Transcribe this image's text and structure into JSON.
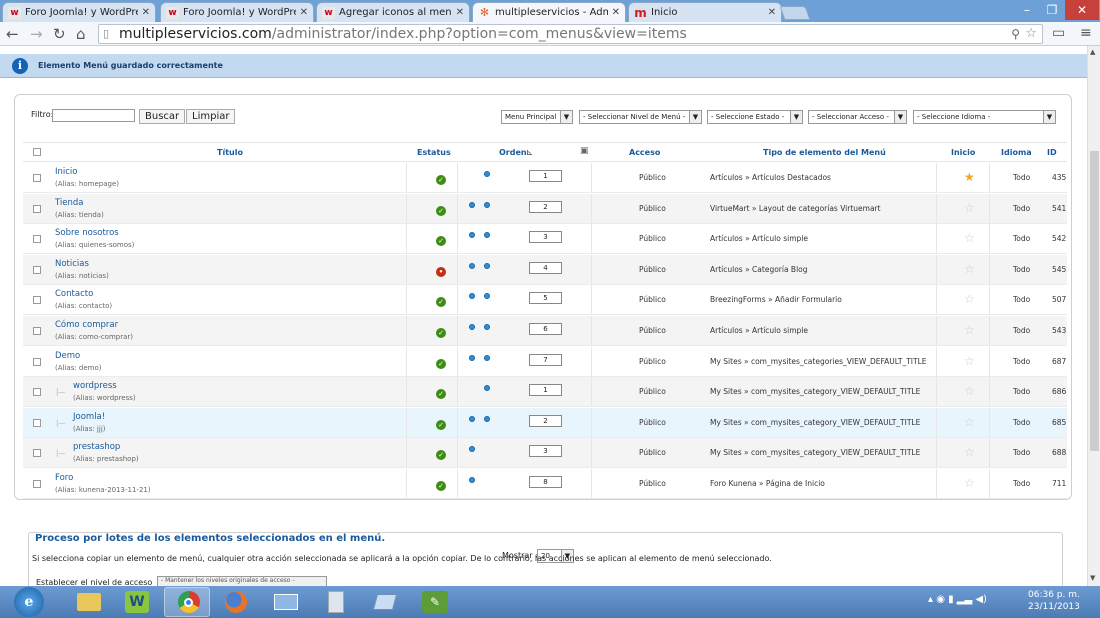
{
  "browser": {
    "tabs": [
      {
        "title": "Foro Joomla! y WordPress",
        "icon": "w",
        "active": false
      },
      {
        "title": "Foro Joomla! y WordPress",
        "icon": "w",
        "active": false
      },
      {
        "title": "Agregar iconos al menu d",
        "icon": "w",
        "active": false
      },
      {
        "title": "multipleservicios - Admin",
        "icon": "joomla",
        "active": true
      },
      {
        "title": "Inicio",
        "icon": "m",
        "active": false
      }
    ],
    "url_host": "multipleservicios.com",
    "url_path": "/administrator/index.php?option=com_menus&view=items"
  },
  "message": "Elemento Menú guardado correctamente",
  "filters": {
    "filtro_label": "Filtro:",
    "search_button": "Buscar",
    "clear_button": "Limpiar",
    "menu_select": "Menu Principal",
    "level_select": "- Seleccionar Nivel de Menú -",
    "state_select": "- Seleccione Estado -",
    "access_select": "- Seleccionar Acceso -",
    "language_select": "- Seleccione Idioma -"
  },
  "table": {
    "headers": {
      "title": "Título",
      "status": "Estatus",
      "order": "Orden",
      "access": "Acceso",
      "type": "Tipo de elemento del Menú",
      "home": "Inicio",
      "language": "Idioma",
      "id": "ID"
    },
    "rows": [
      {
        "title": "Inicio",
        "alias": "(Alias: homepage)",
        "status": "ok",
        "order": "1",
        "access": "Público",
        "type": "Artículos » Artículos Destacados",
        "home": true,
        "lang": "Todo",
        "id": "435",
        "level": 0,
        "up": false,
        "down": true
      },
      {
        "title": "Tienda",
        "alias": "(Alias: tienda)",
        "status": "ok",
        "order": "2",
        "access": "Público",
        "type": "VirtueMart » Layout de categorías Virtuemart",
        "home": false,
        "lang": "Todo",
        "id": "541",
        "level": 0,
        "up": true,
        "down": true
      },
      {
        "title": "Sobre nosotros",
        "alias": "(Alias: quienes-somos)",
        "status": "ok",
        "order": "3",
        "access": "Público",
        "type": "Artículos » Artículo simple",
        "home": false,
        "lang": "Todo",
        "id": "542",
        "level": 0,
        "up": true,
        "down": true
      },
      {
        "title": "Noticias",
        "alias": "(Alias: noticias)",
        "status": "no",
        "order": "4",
        "access": "Público",
        "type": "Artículos » Categoría Blog",
        "home": false,
        "lang": "Todo",
        "id": "545",
        "level": 0,
        "up": true,
        "down": true
      },
      {
        "title": "Contacto",
        "alias": "(Alias: contacto)",
        "status": "ok",
        "order": "5",
        "access": "Público",
        "type": "BreezingForms » Añadir Formulario",
        "home": false,
        "lang": "Todo",
        "id": "507",
        "level": 0,
        "up": true,
        "down": true
      },
      {
        "title": "Cómo comprar",
        "alias": "(Alias: como-comprar)",
        "status": "ok",
        "order": "6",
        "access": "Público",
        "type": "Artículos » Artículo simple",
        "home": false,
        "lang": "Todo",
        "id": "543",
        "level": 0,
        "up": true,
        "down": true
      },
      {
        "title": "Demo",
        "alias": "(Alias: demo)",
        "status": "ok",
        "order": "7",
        "access": "Público",
        "type": "My Sites » com_mysites_categories_VIEW_DEFAULT_TITLE",
        "home": false,
        "lang": "Todo",
        "id": "687",
        "level": 0,
        "up": true,
        "down": true
      },
      {
        "title": "wordpress",
        "alias": "(Alias: wordpress)",
        "status": "ok",
        "order": "1",
        "access": "Público",
        "type": "My Sites » com_mysites_category_VIEW_DEFAULT_TITLE",
        "home": false,
        "lang": "Todo",
        "id": "686",
        "level": 1,
        "up": false,
        "down": true
      },
      {
        "title": "Joomla!",
        "alias": "(Alias: jjj)",
        "status": "ok",
        "order": "2",
        "access": "Público",
        "type": "My Sites » com_mysites_category_VIEW_DEFAULT_TITLE",
        "home": false,
        "lang": "Todo",
        "id": "685",
        "level": 1,
        "up": true,
        "down": true
      },
      {
        "title": "prestashop",
        "alias": "(Alias: prestashop)",
        "status": "ok",
        "order": "3",
        "access": "Público",
        "type": "My Sites » com_mysites_category_VIEW_DEFAULT_TITLE",
        "home": false,
        "lang": "Todo",
        "id": "688",
        "level": 1,
        "up": true,
        "down": false
      },
      {
        "title": "Foro",
        "alias": "(Alias: kunena-2013-11-21)",
        "status": "ok",
        "order": "8",
        "access": "Público",
        "type": "Foro Kunena » Página de Inicio",
        "home": false,
        "lang": "Todo",
        "id": "711",
        "level": 0,
        "up": true,
        "down": false
      }
    ]
  },
  "pagination": {
    "label": "Mostrar #",
    "value": "20"
  },
  "batch": {
    "title": "Proceso por lotes de los elementos seleccionados en el menú.",
    "text": "Si selecciona copiar un elemento de menú, cualquier otra acción seleccionada se aplicará a la opción copiar. De lo contrario, las acciones se aplican al elemento de menú seleccionado.",
    "level_label": "Establecer el nivel de acceso",
    "level_select": "- Mantener los niveles originales de acceso -"
  },
  "taskbar": {
    "time": "06:36 p. m.",
    "date": "23/11/2013"
  },
  "colors": {
    "link": "#1a5a9c",
    "published": "#3d8d14",
    "unpublished": "#c62b14",
    "home_star": "#f0a61e"
  }
}
